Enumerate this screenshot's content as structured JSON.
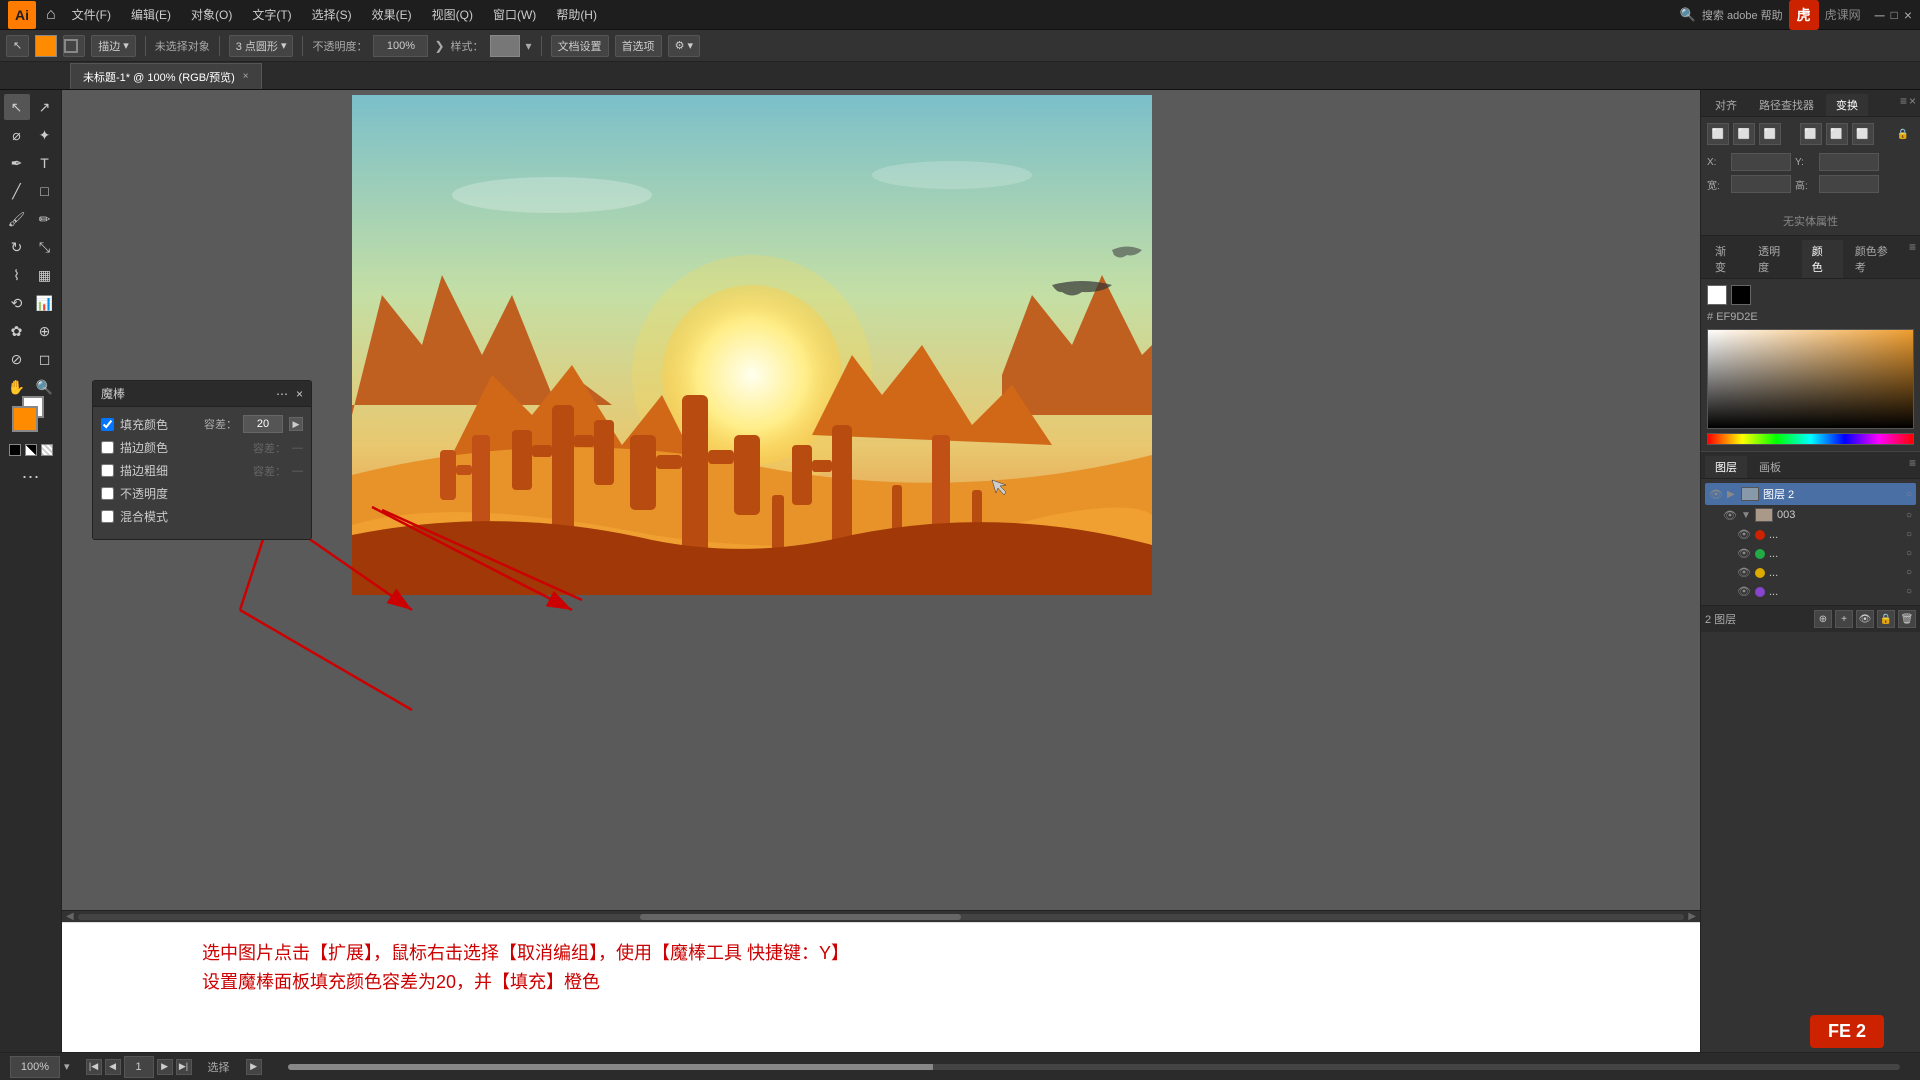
{
  "app": {
    "title": "Adobe Illustrator",
    "logo": "Ai",
    "watermark_logo": "虎",
    "watermark_text": "虎课网"
  },
  "menu": {
    "items": [
      "文件(F)",
      "编辑(E)",
      "对象(O)",
      "文字(T)",
      "选择(S)",
      "效果(E)",
      "视图(Q)",
      "窗口(W)",
      "帮助(H)"
    ]
  },
  "toolbar": {
    "color_swatch_label": "未选择对象",
    "stroke_label": "描边：",
    "mode_label": "描边",
    "points_label": "3 点圆形",
    "opacity_label": "不透明度：",
    "opacity_value": "100%",
    "style_label": "样式：",
    "doc_settings": "文档设置",
    "first_option": "首选项"
  },
  "tab": {
    "label": "未标题-1* @ 100% (RGB/预览)",
    "close": "×"
  },
  "magic_wand_panel": {
    "title": "魔棒",
    "fill_color_label": "填充颜色",
    "fill_color_checked": true,
    "fill_tolerance_label": "容差：",
    "fill_tolerance_value": "20",
    "stroke_color_label": "描边颜色",
    "stroke_color_checked": false,
    "stroke_tolerance_label": "容差：",
    "stroke_weight_label": "描边粗细",
    "stroke_weight_checked": false,
    "stroke_weight_tol": "容差：",
    "opacity_label": "不透明度",
    "opacity_checked": false,
    "blend_mode_label": "混合模式",
    "blend_mode_checked": false
  },
  "right_panel": {
    "tabs": [
      "对齐",
      "路径查找器",
      "变换"
    ],
    "active_tab": "变换",
    "x_label": "X:",
    "y_label": "Y:",
    "w_label": "宽:",
    "h_label": "高:",
    "no_selection": "无实体属性"
  },
  "color_panel": {
    "tabs": [
      "渐变",
      "透明度",
      "颜色",
      "颜色参考"
    ],
    "active_tab": "颜色",
    "hex_value": "EF9D2E",
    "hex_prefix": "#"
  },
  "layers_panel": {
    "tabs": [
      "图层",
      "画板"
    ],
    "active_tab": "图层",
    "layers": [
      {
        "name": "图层 2",
        "visible": true,
        "expanded": true,
        "color": "#2266cc",
        "active": true
      },
      {
        "name": "003",
        "visible": true,
        "expanded": false,
        "color": "#2266cc",
        "active": false
      },
      {
        "name": "...",
        "visible": true,
        "expanded": false,
        "color": "#cc2200",
        "active": false
      },
      {
        "name": "...",
        "visible": true,
        "expanded": false,
        "color": "#22aa44",
        "active": false
      },
      {
        "name": "...",
        "visible": true,
        "expanded": false,
        "color": "#ddaa00",
        "active": false
      },
      {
        "name": "...",
        "visible": true,
        "expanded": false,
        "color": "#8844cc",
        "active": false
      }
    ],
    "footer_label": "2 图层"
  },
  "status_bar": {
    "zoom_value": "100%",
    "page_label": "选择",
    "page_num": "1"
  },
  "instruction": {
    "line1": "选中图片点击【扩展】，鼠标右击选择【取消编组】，使用【魔棒工具 快捷键：Y】",
    "line2": "设置魔棒面板填充颜色容差为20，并【填充】橙色"
  },
  "fe2_badge": {
    "label": "FE 2"
  }
}
